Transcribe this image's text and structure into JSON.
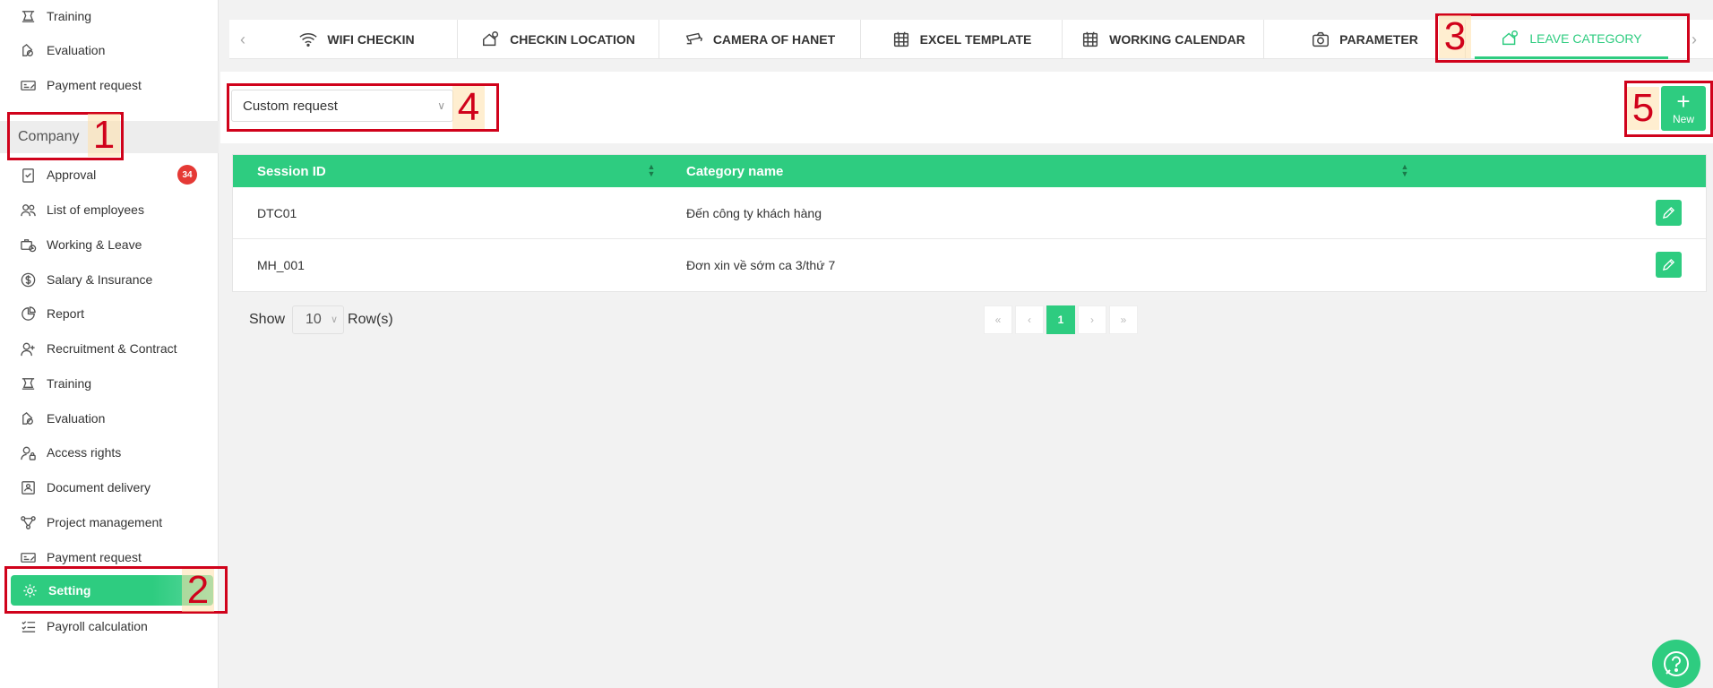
{
  "sidebar": {
    "top_items": [
      {
        "label": "Training",
        "icon": "training-icon"
      },
      {
        "label": "Evaluation",
        "icon": "evaluation-icon"
      },
      {
        "label": "Payment request",
        "icon": "payment-icon"
      }
    ],
    "company_header": "Company",
    "company_items": [
      {
        "label": "Approval",
        "icon": "approval-icon",
        "badge": "34"
      },
      {
        "label": "List of employees",
        "icon": "employees-icon"
      },
      {
        "label": "Working & Leave",
        "icon": "working-leave-icon"
      },
      {
        "label": "Salary & Insurance",
        "icon": "salary-icon"
      },
      {
        "label": "Report",
        "icon": "report-icon"
      },
      {
        "label": "Recruitment & Contract",
        "icon": "recruitment-icon"
      },
      {
        "label": "Training",
        "icon": "training-icon"
      },
      {
        "label": "Evaluation",
        "icon": "evaluation-icon"
      },
      {
        "label": "Access rights",
        "icon": "access-rights-icon"
      },
      {
        "label": "Document delivery",
        "icon": "document-icon"
      },
      {
        "label": "Project management",
        "icon": "project-icon"
      },
      {
        "label": "Payment request",
        "icon": "payment-icon"
      },
      {
        "label": "Setting",
        "icon": "gear-icon",
        "active": true
      },
      {
        "label": "Payroll calculation",
        "icon": "payroll-icon"
      }
    ]
  },
  "tabs": [
    {
      "label": "WIFI CHECKIN",
      "icon": "wifi-icon"
    },
    {
      "label": "CHECKIN LOCATION",
      "icon": "location-icon"
    },
    {
      "label": "CAMERA OF HANET",
      "icon": "camera-icon"
    },
    {
      "label": "EXCEL TEMPLATE",
      "icon": "calendar-icon"
    },
    {
      "label": "WORKING CALENDAR",
      "icon": "calendar-icon"
    },
    {
      "label": "PARAMETER",
      "icon": "parameter-icon"
    },
    {
      "label": "LEAVE CATEGORY",
      "icon": "leave-icon",
      "active": true
    }
  ],
  "filter": {
    "selected": "Custom request",
    "new_label": "New"
  },
  "table": {
    "columns": [
      "Session ID",
      "Category name"
    ],
    "rows": [
      {
        "session_id": "DTC01",
        "category_name": "Đến công ty khách hàng"
      },
      {
        "session_id": "MH_001",
        "category_name": "Đơn xin về sớm ca 3/thứ 7"
      }
    ]
  },
  "pagination": {
    "show_label": "Show",
    "rows_value": "10",
    "rows_label": "Row(s)",
    "first": "«",
    "prev": "‹",
    "current": "1",
    "next": "›",
    "last": "»"
  },
  "annotations": [
    "1",
    "2",
    "3",
    "4",
    "5"
  ],
  "colors": {
    "accent": "#2ecc80",
    "annotation": "#d0021b",
    "badge": "#e53935"
  }
}
